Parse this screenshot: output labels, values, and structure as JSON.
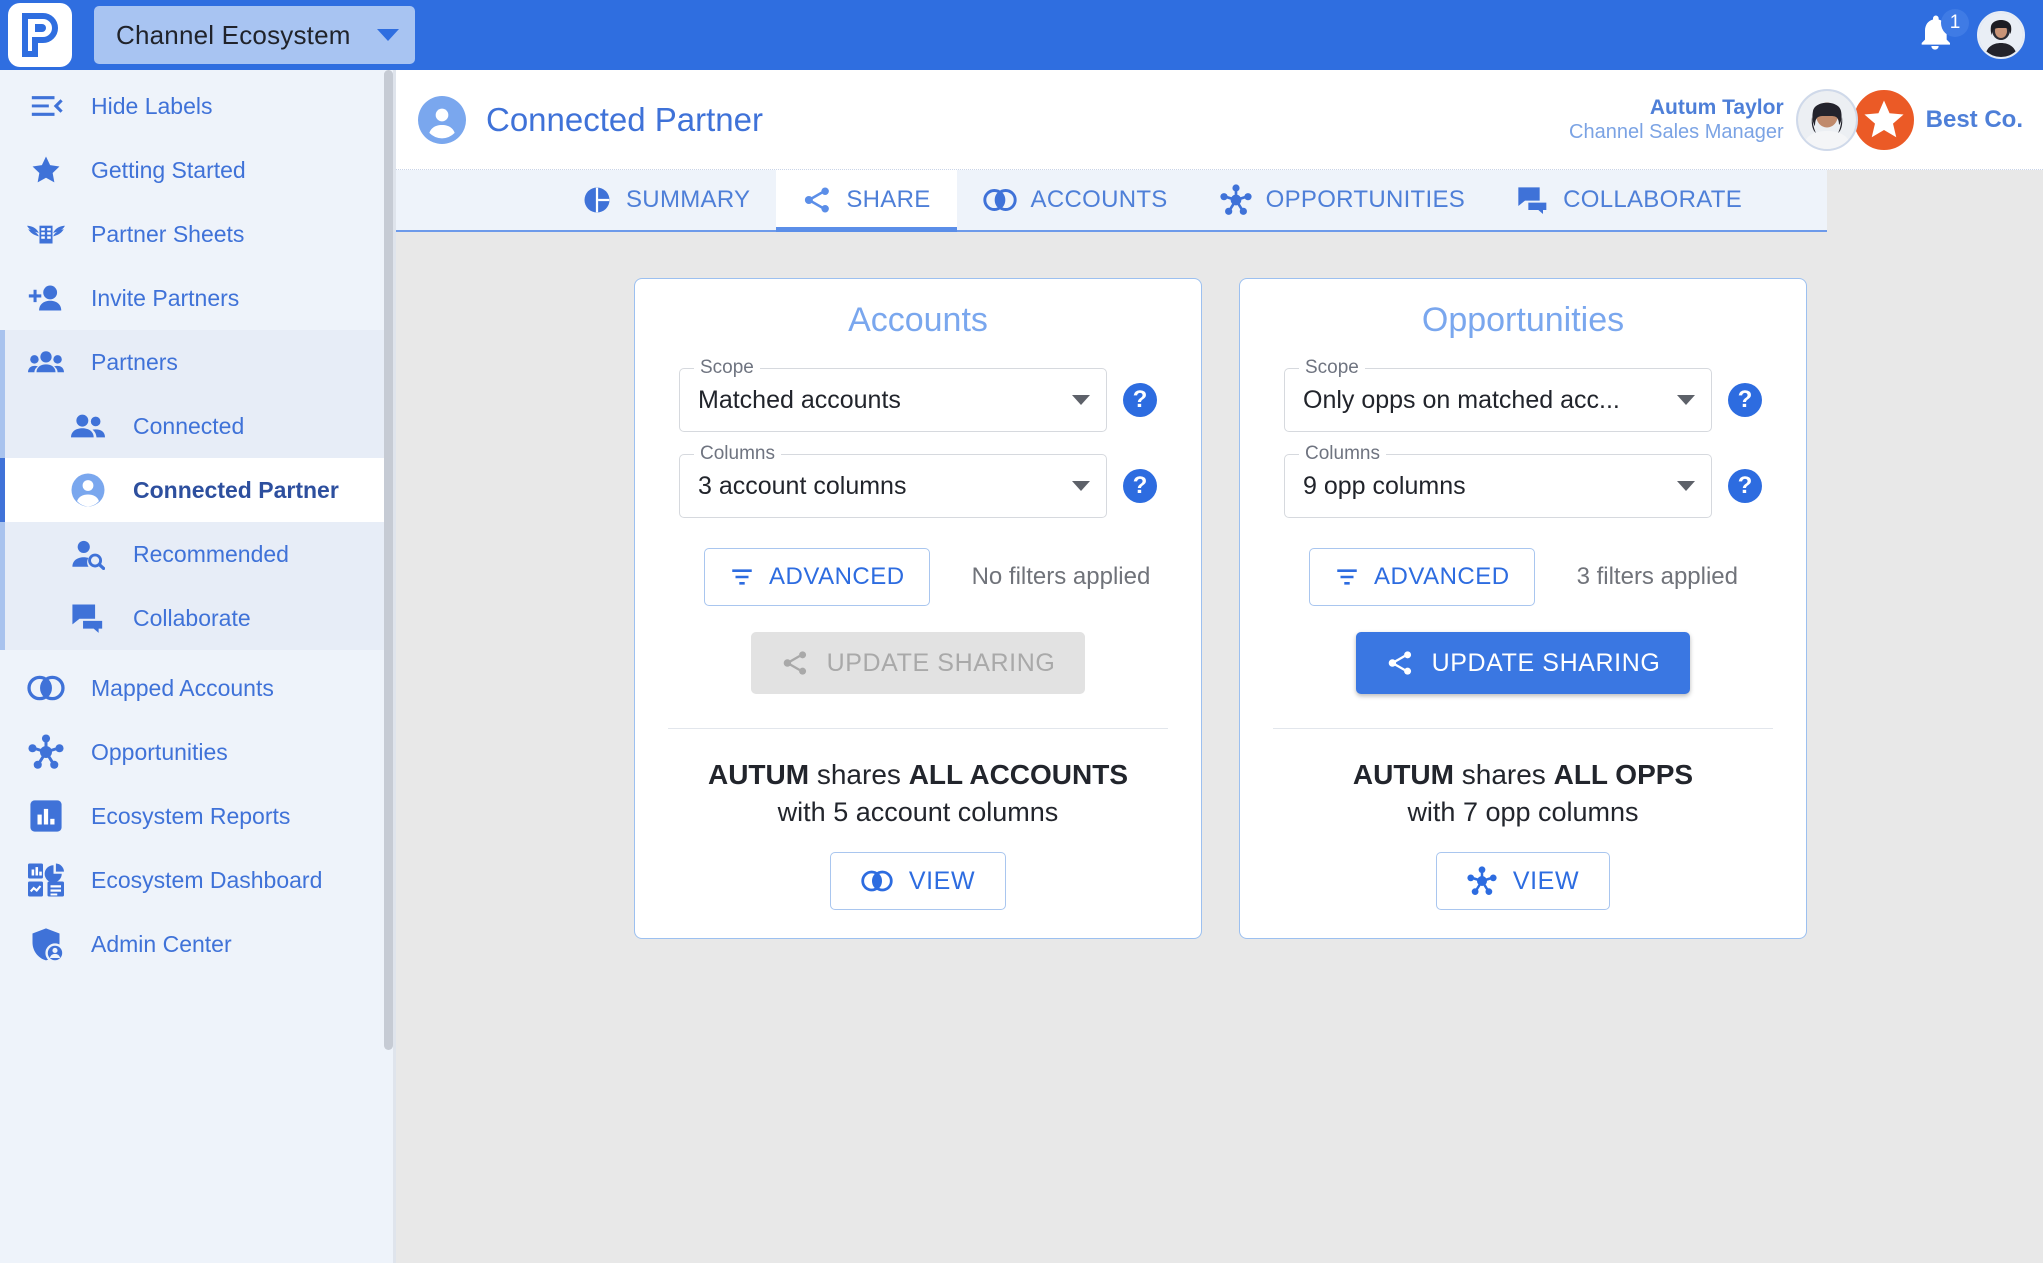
{
  "topbar": {
    "ecosystem_label": "Channel Ecosystem",
    "notification_count": "1"
  },
  "sidebar": {
    "items": [
      {
        "label": "Hide Labels",
        "icon": "hide-labels-icon"
      },
      {
        "label": "Getting Started",
        "icon": "star-icon"
      },
      {
        "label": "Partner Sheets",
        "icon": "winged-sheet-icon"
      },
      {
        "label": "Invite Partners",
        "icon": "person-add-icon"
      },
      {
        "label": "Partners",
        "icon": "people-group-icon"
      },
      {
        "label": "Connected",
        "icon": "people-icon"
      },
      {
        "label": "Connected Partner",
        "icon": "person-circle-icon"
      },
      {
        "label": "Recommended",
        "icon": "person-search-icon"
      },
      {
        "label": "Collaborate",
        "icon": "chat-icon"
      },
      {
        "label": "Mapped Accounts",
        "icon": "venn-icon"
      },
      {
        "label": "Opportunities",
        "icon": "hub-icon"
      },
      {
        "label": "Ecosystem Reports",
        "icon": "bar-chart-icon"
      },
      {
        "label": "Ecosystem Dashboard",
        "icon": "dashboard-icon"
      },
      {
        "label": "Admin Center",
        "icon": "shield-person-icon"
      }
    ]
  },
  "header": {
    "page_title": "Connected Partner",
    "user_name": "Autum Taylor",
    "user_role": "Channel Sales Manager",
    "company_name": "Best Co."
  },
  "tabs": [
    {
      "label": "SUMMARY",
      "icon": "pie-chart-icon",
      "active": false
    },
    {
      "label": "SHARE",
      "icon": "share-icon",
      "active": true
    },
    {
      "label": "ACCOUNTS",
      "icon": "venn-icon",
      "active": false
    },
    {
      "label": "OPPORTUNITIES",
      "icon": "hub-icon",
      "active": false
    },
    {
      "label": "COLLABORATE",
      "icon": "chat-icon",
      "active": false
    }
  ],
  "accounts_card": {
    "title": "Accounts",
    "scope_legend": "Scope",
    "scope_value": "Matched accounts",
    "columns_legend": "Columns",
    "columns_value": "3 account columns",
    "advanced_label": "ADVANCED",
    "filters_note": "No filters applied",
    "update_label": "UPDATE SHARING",
    "update_enabled": false,
    "summary_prefix": "AUTUM",
    "summary_mid": " shares ",
    "summary_target": "ALL ACCOUNTS",
    "summary_columns": "with 5 account columns",
    "view_label": "VIEW"
  },
  "opportunities_card": {
    "title": "Opportunities",
    "scope_legend": "Scope",
    "scope_value": "Only opps on matched acc...",
    "columns_legend": "Columns",
    "columns_value": "9 opp columns",
    "advanced_label": "ADVANCED",
    "filters_note": "3 filters applied",
    "update_label": "UPDATE SHARING",
    "update_enabled": true,
    "summary_prefix": "AUTUM",
    "summary_mid": " shares ",
    "summary_target": "ALL OPPS",
    "summary_columns": "with 7 opp columns",
    "view_label": "VIEW"
  },
  "help_glyph": "?",
  "colors": {
    "brand_blue": "#2f6ee0",
    "accent_blue": "#3f72d8",
    "light_blue": "#7aa7ee",
    "panel_bg": "#eef3fa",
    "content_bg": "#e8e8e8",
    "company_orange": "#eb5a26"
  }
}
